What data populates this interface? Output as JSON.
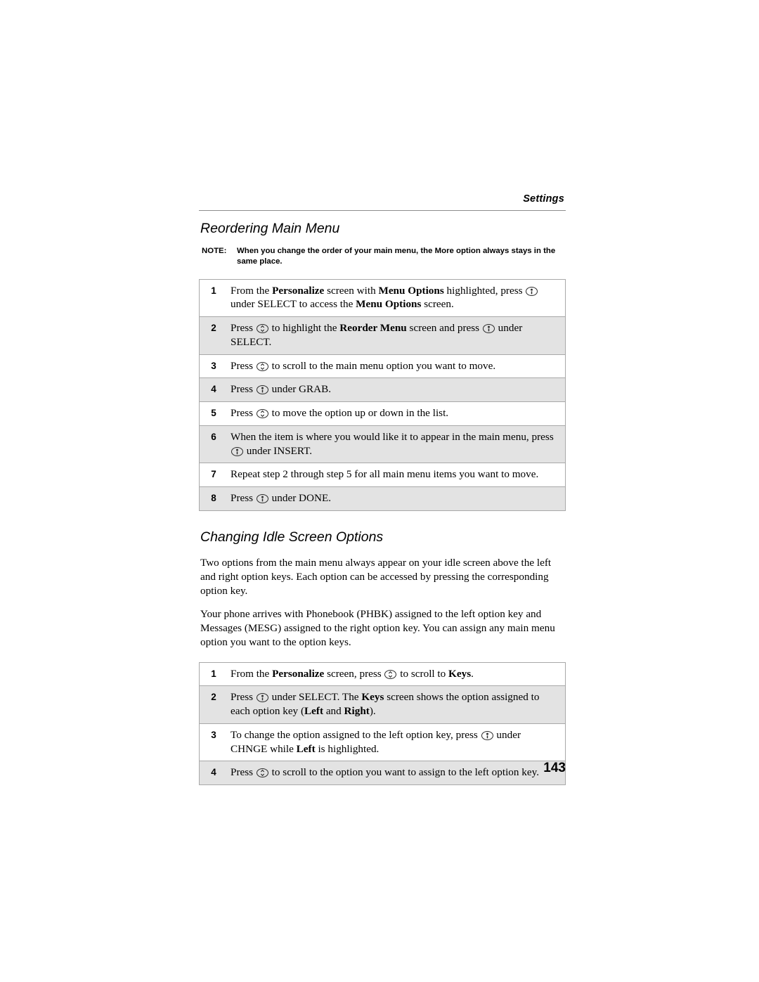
{
  "running_head": "Settings",
  "page_number": "143",
  "icons": {
    "select_key": "select-key-icon",
    "scroll_key": "scroll-key-icon"
  },
  "sections": [
    {
      "heading": "Reordering Main Menu",
      "note": {
        "label": "NOTE:",
        "text": "When you change the order of your main menu, the More option always stays in the same place."
      },
      "steps": [
        {
          "num": "1",
          "shaded": false
        },
        {
          "num": "2",
          "shaded": true
        },
        {
          "num": "3",
          "shaded": false
        },
        {
          "num": "4",
          "shaded": true
        },
        {
          "num": "5",
          "shaded": false
        },
        {
          "num": "6",
          "shaded": true
        },
        {
          "num": "7",
          "shaded": false
        },
        {
          "num": "8",
          "shaded": true
        }
      ],
      "step_text": {
        "s1": {
          "a": "From the ",
          "b1": "Personalize",
          "c": " screen with ",
          "b2": "Menu Options",
          "d": " highlighted, press ",
          "e": " under SELECT to access the ",
          "b3": "Menu Options",
          "f": " screen."
        },
        "s2": {
          "a": "Press ",
          "b": " to highlight the ",
          "b1": "Reorder Menu",
          "c": " screen and press ",
          "d": " under SELECT."
        },
        "s3": {
          "a": "Press ",
          "b": " to scroll to the main menu option you want to move."
        },
        "s4": {
          "a": "Press ",
          "b": " under GRAB."
        },
        "s5": {
          "a": "Press ",
          "b": " to move the option up or down in the list."
        },
        "s6": {
          "a": "When the item is where you would like it to appear in the main menu, press ",
          "b": " under INSERT."
        },
        "s7": {
          "a": "Repeat step 2 through step 5 for all main menu items you want to move."
        },
        "s8": {
          "a": "Press ",
          "b": " under DONE."
        }
      }
    },
    {
      "heading": "Changing Idle Screen Options",
      "paragraphs": [
        "Two options from the main menu always appear on your idle screen above the left and right option keys. Each option can be accessed by pressing the corresponding option key.",
        "Your phone arrives with Phonebook (PHBK) assigned to the left option key and Messages (MESG) assigned to the right option key. You can assign any main menu option you want to the option keys."
      ],
      "steps": [
        {
          "num": "1",
          "shaded": false
        },
        {
          "num": "2",
          "shaded": true
        },
        {
          "num": "3",
          "shaded": false
        },
        {
          "num": "4",
          "shaded": true
        }
      ],
      "step_text": {
        "k1": {
          "a": "From the ",
          "b1": "Personalize",
          "c": " screen, press ",
          "d": " to scroll to ",
          "b2": "Keys",
          "e": "."
        },
        "k2": {
          "a": "Press ",
          "b": " under SELECT. The ",
          "b1": "Keys",
          "c": " screen shows the option assigned to each option key (",
          "b2": "Left",
          "d": " and ",
          "b3": "Right",
          "e": ")."
        },
        "k3": {
          "a": "To change the option assigned to the left option key, press ",
          "b": " under CHNGE while ",
          "b1": "Left",
          "c": " is highlighted."
        },
        "k4": {
          "a": "Press ",
          "b": " to scroll to the option you want to assign to the left option key."
        }
      }
    }
  ]
}
